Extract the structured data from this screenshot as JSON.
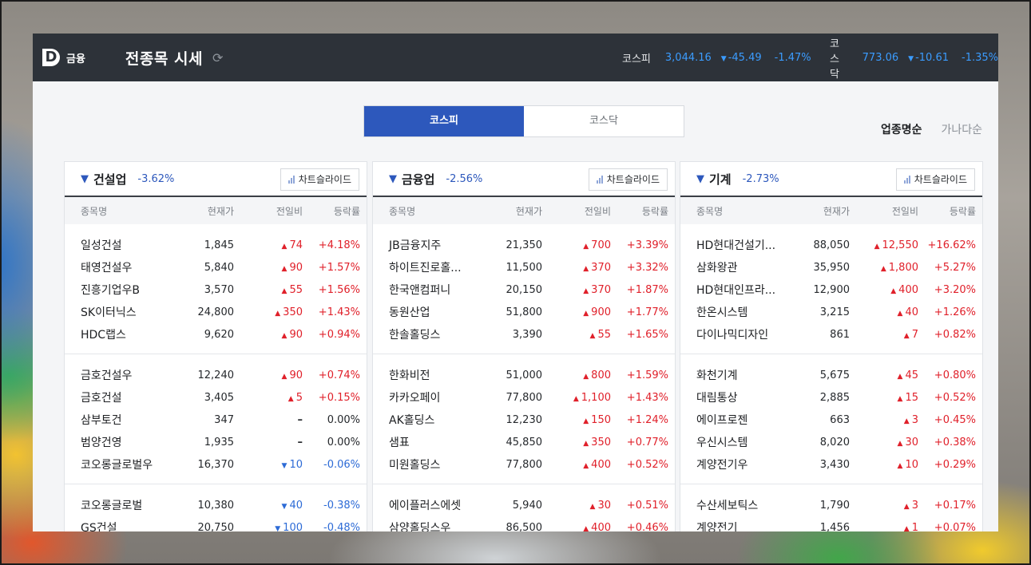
{
  "header": {
    "logo_mark": "D",
    "logo_text": "금융",
    "title": "전종목 시세",
    "kospi": {
      "name": "코스피",
      "value": "3,044.16",
      "change": "-45.49",
      "rate": "-1.47%"
    },
    "kosdaq": {
      "name": "코스닥",
      "value": "773.06",
      "change": "-10.61",
      "rate": "-1.35%"
    }
  },
  "tabs": [
    {
      "label": "코스피",
      "active": true
    },
    {
      "label": "코스닥",
      "active": false
    }
  ],
  "sort": {
    "by_sector": "업종명순",
    "by_name": "가나다순"
  },
  "columns": {
    "name": "종목명",
    "price": "현재가",
    "change": "전일비",
    "rate": "등락률"
  },
  "chart_button_label": "차트슬라이드",
  "colors": {
    "up": "#e0202a",
    "down": "#2d6bd6",
    "accent": "#2d58bc",
    "topbar": "#2d3239"
  },
  "sectors": [
    {
      "name": "건설업",
      "rate": "-3.62%",
      "groups": [
        [
          {
            "name": "일성건설",
            "price": "1,845",
            "dir": "up",
            "change": "74",
            "rate": "+4.18%"
          },
          {
            "name": "태영건설우",
            "price": "5,840",
            "dir": "up",
            "change": "90",
            "rate": "+1.57%"
          },
          {
            "name": "진흥기업우B",
            "price": "3,570",
            "dir": "up",
            "change": "55",
            "rate": "+1.56%"
          },
          {
            "name": "SK이터닉스",
            "price": "24,800",
            "dir": "up",
            "change": "350",
            "rate": "+1.43%"
          },
          {
            "name": "HDC랩스",
            "price": "9,620",
            "dir": "up",
            "change": "90",
            "rate": "+0.94%"
          }
        ],
        [
          {
            "name": "금호건설우",
            "price": "12,240",
            "dir": "up",
            "change": "90",
            "rate": "+0.74%"
          },
          {
            "name": "금호건설",
            "price": "3,405",
            "dir": "up",
            "change": "5",
            "rate": "+0.15%"
          },
          {
            "name": "삼부토건",
            "price": "347",
            "dir": "flat",
            "change": "",
            "rate": "0.00%"
          },
          {
            "name": "범양건영",
            "price": "1,935",
            "dir": "flat",
            "change": "",
            "rate": "0.00%"
          },
          {
            "name": "코오롱글로벌우",
            "price": "16,370",
            "dir": "down",
            "change": "10",
            "rate": "-0.06%"
          }
        ],
        [
          {
            "name": "코오롱글로벌",
            "price": "10,380",
            "dir": "down",
            "change": "40",
            "rate": "-0.38%"
          },
          {
            "name": "GS건설",
            "price": "20,750",
            "dir": "down",
            "change": "100",
            "rate": "-0.48%"
          }
        ]
      ]
    },
    {
      "name": "금융업",
      "rate": "-2.56%",
      "groups": [
        [
          {
            "name": "JB금융지주",
            "price": "21,350",
            "dir": "up",
            "change": "700",
            "rate": "+3.39%"
          },
          {
            "name": "하이트진로홀...",
            "price": "11,500",
            "dir": "up",
            "change": "370",
            "rate": "+3.32%"
          },
          {
            "name": "한국앤컴퍼니",
            "price": "20,150",
            "dir": "up",
            "change": "370",
            "rate": "+1.87%"
          },
          {
            "name": "동원산업",
            "price": "51,800",
            "dir": "up",
            "change": "900",
            "rate": "+1.77%"
          },
          {
            "name": "한솔홀딩스",
            "price": "3,390",
            "dir": "up",
            "change": "55",
            "rate": "+1.65%"
          }
        ],
        [
          {
            "name": "한화비전",
            "price": "51,000",
            "dir": "up",
            "change": "800",
            "rate": "+1.59%"
          },
          {
            "name": "카카오페이",
            "price": "77,800",
            "dir": "up",
            "change": "1,100",
            "rate": "+1.43%"
          },
          {
            "name": "AK홀딩스",
            "price": "12,230",
            "dir": "up",
            "change": "150",
            "rate": "+1.24%"
          },
          {
            "name": "샘표",
            "price": "45,850",
            "dir": "up",
            "change": "350",
            "rate": "+0.77%"
          },
          {
            "name": "미원홀딩스",
            "price": "77,800",
            "dir": "up",
            "change": "400",
            "rate": "+0.52%"
          }
        ],
        [
          {
            "name": "에이플러스에셋",
            "price": "5,940",
            "dir": "up",
            "change": "30",
            "rate": "+0.51%"
          },
          {
            "name": "삼양홀딩스우",
            "price": "86,500",
            "dir": "up",
            "change": "400",
            "rate": "+0.46%"
          }
        ]
      ]
    },
    {
      "name": "기계",
      "rate": "-2.73%",
      "groups": [
        [
          {
            "name": "HD현대건설기...",
            "price": "88,050",
            "dir": "up",
            "change": "12,550",
            "rate": "+16.62%"
          },
          {
            "name": "삼화왕관",
            "price": "35,950",
            "dir": "up",
            "change": "1,800",
            "rate": "+5.27%"
          },
          {
            "name": "HD현대인프라...",
            "price": "12,900",
            "dir": "up",
            "change": "400",
            "rate": "+3.20%"
          },
          {
            "name": "한온시스템",
            "price": "3,215",
            "dir": "up",
            "change": "40",
            "rate": "+1.26%"
          },
          {
            "name": "다이나믹디자인",
            "price": "861",
            "dir": "up",
            "change": "7",
            "rate": "+0.82%"
          }
        ],
        [
          {
            "name": "화천기계",
            "price": "5,675",
            "dir": "up",
            "change": "45",
            "rate": "+0.80%"
          },
          {
            "name": "대림통상",
            "price": "2,885",
            "dir": "up",
            "change": "15",
            "rate": "+0.52%"
          },
          {
            "name": "에이프로젠",
            "price": "663",
            "dir": "up",
            "change": "3",
            "rate": "+0.45%"
          },
          {
            "name": "우신시스템",
            "price": "8,020",
            "dir": "up",
            "change": "30",
            "rate": "+0.38%"
          },
          {
            "name": "계양전기우",
            "price": "3,430",
            "dir": "up",
            "change": "10",
            "rate": "+0.29%"
          }
        ],
        [
          {
            "name": "수산세보틱스",
            "price": "1,790",
            "dir": "up",
            "change": "3",
            "rate": "+0.17%"
          },
          {
            "name": "계양전기",
            "price": "1,456",
            "dir": "up",
            "change": "1",
            "rate": "+0.07%"
          }
        ]
      ]
    }
  ]
}
